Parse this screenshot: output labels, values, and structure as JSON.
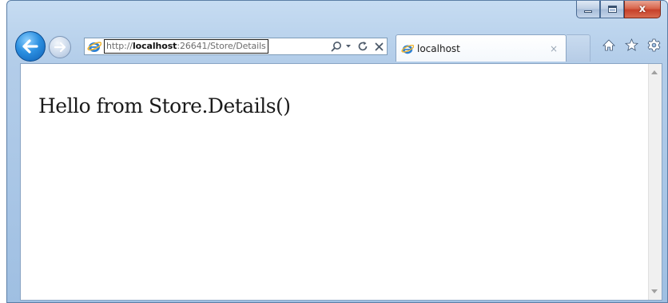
{
  "window": {
    "caption": {
      "minimize_icon": "minimize-icon",
      "maximize_icon": "maximize-icon",
      "close_glyph": "x"
    }
  },
  "nav": {
    "back_icon": "back-arrow-icon",
    "forward_icon": "forward-arrow-icon"
  },
  "address": {
    "url_prefix": "http://",
    "url_host": "localhost",
    "url_rest": ":26641/Store/Details",
    "tools": {
      "search_icon": "search-icon",
      "dropdown_icon": "dropdown-icon",
      "refresh_icon": "refresh-icon",
      "stop_icon": "stop-icon"
    }
  },
  "tab": {
    "label": "localhost",
    "close_glyph": "×"
  },
  "commands": {
    "home_icon": "home-icon",
    "favorites_icon": "star-icon",
    "tools_icon": "gear-icon"
  },
  "page": {
    "text": "Hello from Store.Details()"
  },
  "colors": {
    "frame": "#b3cde9",
    "back_button": "#2b8fe0",
    "close_button": "#c6412a"
  }
}
